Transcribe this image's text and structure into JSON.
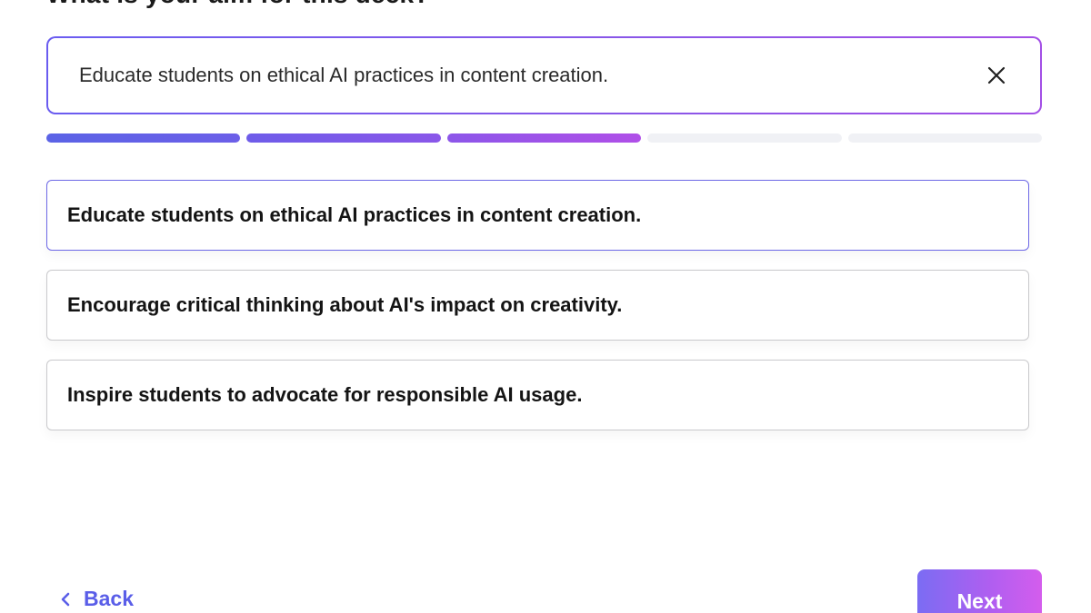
{
  "header": {
    "question": "What is your aim for this deck?"
  },
  "aim_input": {
    "value": "Educate students on ethical AI practices in content creation.",
    "clear_icon": "close-icon"
  },
  "progress": {
    "total_steps": 5,
    "completed_steps": 3,
    "colors": [
      "#5b63e6",
      "#8a57e9",
      "#b04fe8",
      "#f0f1f5"
    ]
  },
  "suggestions": [
    {
      "label": "Educate students on ethical AI practices in content creation.",
      "selected": true
    },
    {
      "label": "Encourage critical thinking about AI's impact on creativity.",
      "selected": false
    },
    {
      "label": "Inspire students to advocate for responsible AI usage.",
      "selected": false
    }
  ],
  "footer": {
    "back_label": "Back",
    "back_icon": "chevron-left-icon",
    "next_label": "Next"
  },
  "colors": {
    "accent": "#5a5ee8",
    "selected_border": "#6d68e6",
    "next_gradient_start": "#7b6cf3",
    "next_gradient_end": "#d45ded"
  }
}
